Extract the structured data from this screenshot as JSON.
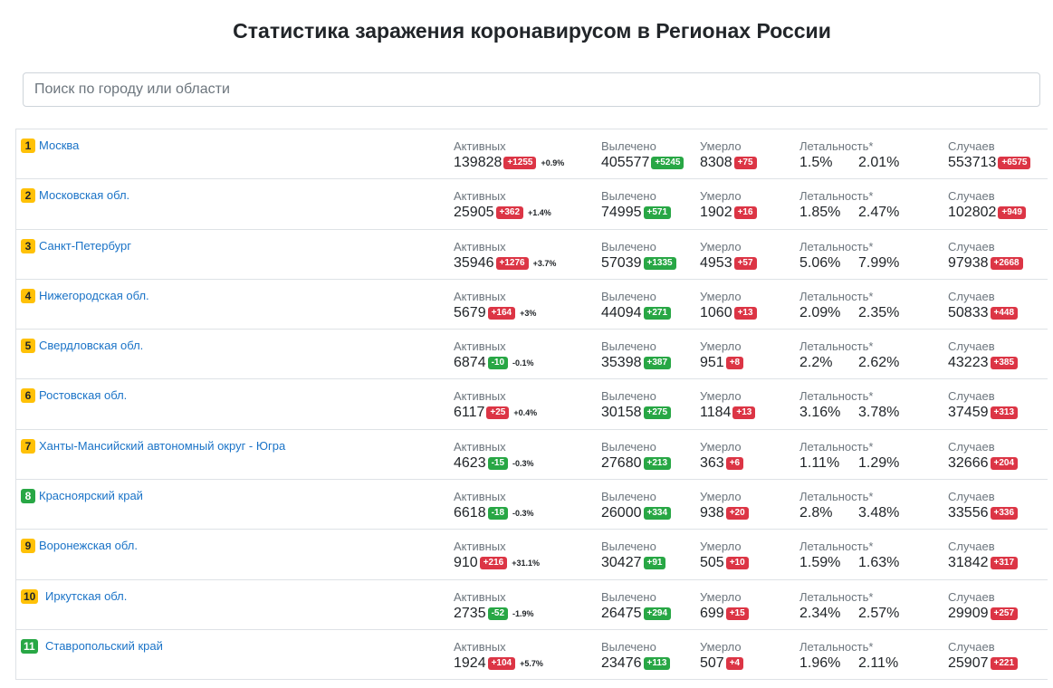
{
  "title": "Статистика заражения коронавирусом в Регионах России",
  "search": {
    "placeholder": "Поиск по городу или области"
  },
  "labels": {
    "active": "Активных",
    "recovered": "Вылечено",
    "died": "Умерло",
    "lethality": "Летальность*",
    "cases": "Случаев"
  },
  "colors": {
    "accent_link": "#1a73c7",
    "badge_red": "#dc3545",
    "badge_green": "#28a745",
    "rank_yellow": "#ffc107"
  },
  "regions": [
    {
      "rank": "1",
      "rank_color": "yellow",
      "name": "Москва",
      "active": "139828",
      "active_delta": "+1255",
      "active_delta_color": "red",
      "active_pct": "+0.9%",
      "recovered": "405577",
      "recovered_delta": "+5245",
      "died": "8308",
      "died_delta": "+75",
      "lethality_1": "1.5%",
      "lethality_2": "2.01%",
      "cases": "553713",
      "cases_delta": "+6575"
    },
    {
      "rank": "2",
      "rank_color": "yellow",
      "name": "Московская обл.",
      "active": "25905",
      "active_delta": "+362",
      "active_delta_color": "red",
      "active_pct": "+1.4%",
      "recovered": "74995",
      "recovered_delta": "+571",
      "died": "1902",
      "died_delta": "+16",
      "lethality_1": "1.85%",
      "lethality_2": "2.47%",
      "cases": "102802",
      "cases_delta": "+949"
    },
    {
      "rank": "3",
      "rank_color": "yellow",
      "name": "Санкт-Петербург",
      "active": "35946",
      "active_delta": "+1276",
      "active_delta_color": "red",
      "active_pct": "+3.7%",
      "recovered": "57039",
      "recovered_delta": "+1335",
      "died": "4953",
      "died_delta": "+57",
      "lethality_1": "5.06%",
      "lethality_2": "7.99%",
      "cases": "97938",
      "cases_delta": "+2668"
    },
    {
      "rank": "4",
      "rank_color": "yellow",
      "name": "Нижегородская обл.",
      "active": "5679",
      "active_delta": "+164",
      "active_delta_color": "red",
      "active_pct": "+3%",
      "recovered": "44094",
      "recovered_delta": "+271",
      "died": "1060",
      "died_delta": "+13",
      "lethality_1": "2.09%",
      "lethality_2": "2.35%",
      "cases": "50833",
      "cases_delta": "+448"
    },
    {
      "rank": "5",
      "rank_color": "yellow",
      "name": "Свердловская обл.",
      "active": "6874",
      "active_delta": "-10",
      "active_delta_color": "green",
      "active_pct": "-0.1%",
      "recovered": "35398",
      "recovered_delta": "+387",
      "died": "951",
      "died_delta": "+8",
      "lethality_1": "2.2%",
      "lethality_2": "2.62%",
      "cases": "43223",
      "cases_delta": "+385"
    },
    {
      "rank": "6",
      "rank_color": "yellow",
      "name": "Ростовская обл.",
      "active": "6117",
      "active_delta": "+25",
      "active_delta_color": "red",
      "active_pct": "+0.4%",
      "recovered": "30158",
      "recovered_delta": "+275",
      "died": "1184",
      "died_delta": "+13",
      "lethality_1": "3.16%",
      "lethality_2": "3.78%",
      "cases": "37459",
      "cases_delta": "+313"
    },
    {
      "rank": "7",
      "rank_color": "yellow",
      "name": "Ханты-Мансийский автономный округ - Югра",
      "active": "4623",
      "active_delta": "-15",
      "active_delta_color": "green",
      "active_pct": "-0.3%",
      "recovered": "27680",
      "recovered_delta": "+213",
      "died": "363",
      "died_delta": "+6",
      "lethality_1": "1.11%",
      "lethality_2": "1.29%",
      "cases": "32666",
      "cases_delta": "+204"
    },
    {
      "rank": "8",
      "rank_color": "green",
      "name": "Красноярский край",
      "active": "6618",
      "active_delta": "-18",
      "active_delta_color": "green",
      "active_pct": "-0.3%",
      "recovered": "26000",
      "recovered_delta": "+334",
      "died": "938",
      "died_delta": "+20",
      "lethality_1": "2.8%",
      "lethality_2": "3.48%",
      "cases": "33556",
      "cases_delta": "+336"
    },
    {
      "rank": "9",
      "rank_color": "yellow",
      "name": "Воронежская обл.",
      "active": "910",
      "active_delta": "+216",
      "active_delta_color": "red",
      "active_pct": "+31.1%",
      "recovered": "30427",
      "recovered_delta": "+91",
      "died": "505",
      "died_delta": "+10",
      "lethality_1": "1.59%",
      "lethality_2": "1.63%",
      "cases": "31842",
      "cases_delta": "+317"
    },
    {
      "rank": "10",
      "rank_color": "yellow",
      "name": "Иркутская обл.",
      "active": "2735",
      "active_delta": "-52",
      "active_delta_color": "green",
      "active_pct": "-1.9%",
      "recovered": "26475",
      "recovered_delta": "+294",
      "died": "699",
      "died_delta": "+15",
      "lethality_1": "2.34%",
      "lethality_2": "2.57%",
      "cases": "29909",
      "cases_delta": "+257"
    },
    {
      "rank": "11",
      "rank_color": "green",
      "name": "Ставропольский край",
      "active": "1924",
      "active_delta": "+104",
      "active_delta_color": "red",
      "active_pct": "+5.7%",
      "recovered": "23476",
      "recovered_delta": "+113",
      "died": "507",
      "died_delta": "+4",
      "lethality_1": "1.96%",
      "lethality_2": "2.11%",
      "cases": "25907",
      "cases_delta": "+221"
    }
  ]
}
